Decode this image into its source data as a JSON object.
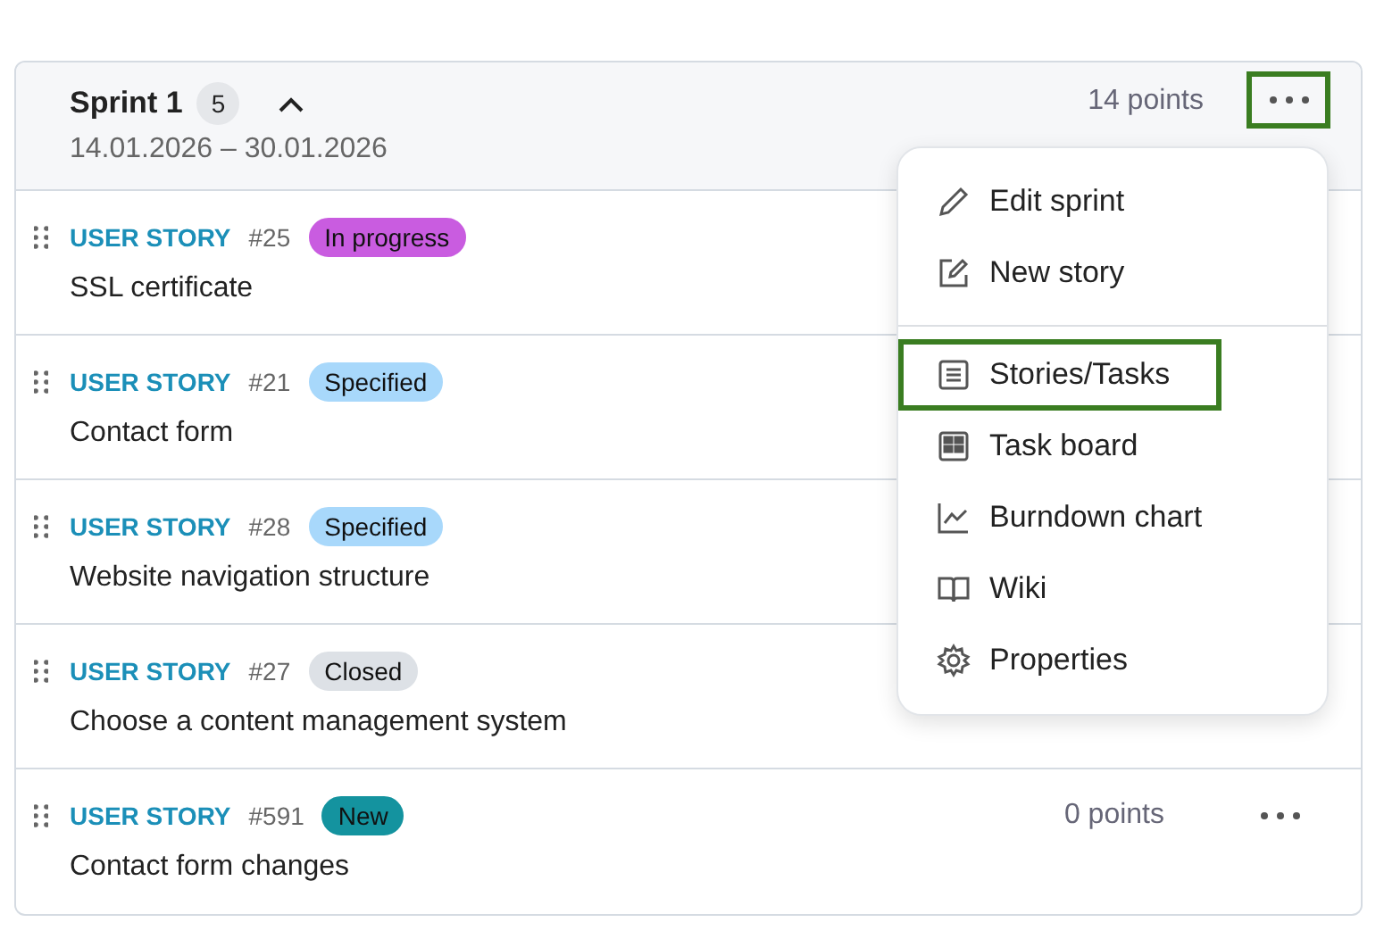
{
  "sprint": {
    "title": "Sprint 1",
    "count": "5",
    "expanded": true,
    "dates": "14.01.2026 – 30.01.2026",
    "points": "14 points",
    "more_highlighted": true
  },
  "stories": [
    {
      "type": "USER STORY",
      "number": "#25",
      "status": "In progress",
      "color": "#c95ce0",
      "title": "SSL certificate"
    },
    {
      "type": "USER STORY",
      "number": "#21",
      "status": "Specified",
      "color": "#a8d8fb",
      "title": "Contact form"
    },
    {
      "type": "USER STORY",
      "number": "#28",
      "status": "Specified",
      "color": "#a8d8fb",
      "title": "Website navigation structure"
    },
    {
      "type": "USER STORY",
      "number": "#27",
      "status": "Closed",
      "color": "#dde1e6",
      "title": "Choose a content management system"
    },
    {
      "type": "USER STORY",
      "number": "#591",
      "status": "New",
      "color": "#14939f",
      "title": "Contact form changes",
      "points": "0 points",
      "more": true
    }
  ],
  "menu": {
    "groups": [
      [
        {
          "kind": "pencil",
          "label": "Edit sprint",
          "highlighted": false
        },
        {
          "kind": "edit",
          "label": "New story",
          "highlighted": false
        }
      ],
      [
        {
          "kind": "list",
          "label": "Stories/Tasks",
          "highlighted": true
        },
        {
          "kind": "board",
          "label": "Task board",
          "highlighted": false
        },
        {
          "kind": "chart",
          "label": "Burndown chart",
          "highlighted": false
        },
        {
          "kind": "book",
          "label": "Wiki",
          "highlighted": false
        },
        {
          "kind": "gear",
          "label": "Properties",
          "highlighted": false
        }
      ]
    ]
  }
}
